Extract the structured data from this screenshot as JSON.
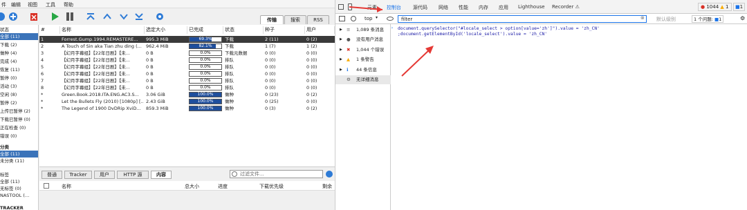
{
  "qb": {
    "menu": [
      "件",
      "编辑",
      "视图",
      "工具",
      "帮助"
    ],
    "search_tabs": [
      "传输",
      "搜索",
      "RSS"
    ],
    "sidebar": {
      "status_header": "状态",
      "status_items": [
        "全部 (11)",
        "下载 (2)",
        "做种 (4)",
        "完成 (4)",
        "恢复 (11)",
        "暂停 (0)",
        "活动 (3)",
        "空闲 (8)",
        "暂停 (2)",
        "上传已暂停 (2)",
        "下载已暂停 (0)",
        "正在检查 (0)",
        "错误 (0)"
      ],
      "category_header": "分类",
      "category_items": [
        "全部 (11)",
        "未分类 (11)"
      ],
      "tag_header": "标签",
      "tag_items": [
        "全部 (11)",
        "无标签 (0)",
        "NASTOOL (…"
      ],
      "tracker_header": "TRACKER"
    },
    "columns": [
      "#",
      "名称",
      "选定大小",
      "已完成",
      "状态",
      "种子",
      "用户"
    ],
    "rows": [
      {
        "num": "1",
        "name": "Forrest.Gump.1994.REMASTERE...",
        "size": "995.3 MiB",
        "progress": 69.3,
        "progress_label": "69.3%",
        "status": "下载",
        "seeds": "2 (11)",
        "peers": "0 (2)"
      },
      {
        "num": "2",
        "name": "A Touch of Sin aka Tian zhu ding (...",
        "size": "962.4 MiB",
        "progress": 82.1,
        "progress_label": "82.1%",
        "status": "下载",
        "seeds": "1 (7)",
        "peers": "1 (2)"
      },
      {
        "num": "3",
        "name": "【幻月字幕组】【22年日剧】【未...",
        "size": "0 B",
        "progress": 0,
        "progress_label": "0.0%",
        "status": "下载元数据",
        "seeds": "0 (0)",
        "peers": "0 (0)"
      },
      {
        "num": "4",
        "name": "【幻月字幕组】【22年日剧】【未...",
        "size": "0 B",
        "progress": 0,
        "progress_label": "0.0%",
        "status": "排队",
        "seeds": "0 (0)",
        "peers": "0 (0)"
      },
      {
        "num": "5",
        "name": "【幻月字幕组】【22年日剧】【未...",
        "size": "0 B",
        "progress": 0,
        "progress_label": "0.0%",
        "status": "排队",
        "seeds": "0 (0)",
        "peers": "0 (0)"
      },
      {
        "num": "6",
        "name": "【幻月字幕组】【22年日剧】【未...",
        "size": "0 B",
        "progress": 0,
        "progress_label": "0.0%",
        "status": "排队",
        "seeds": "0 (0)",
        "peers": "0 (0)"
      },
      {
        "num": "7",
        "name": "【幻月字幕组】【22年日剧】【未...",
        "size": "0 B",
        "progress": 0,
        "progress_label": "0.0%",
        "status": "排队",
        "seeds": "0 (0)",
        "peers": "0 (0)"
      },
      {
        "num": "8",
        "name": "【幻月字幕组】【22年日剧】【未...",
        "size": "0 B",
        "progress": 0,
        "progress_label": "0.0%",
        "status": "排队",
        "seeds": "0 (0)",
        "peers": "0 (0)"
      },
      {
        "num": "*",
        "name": "Green.Book.2018.ITA.ENG.AC3.S...",
        "size": "3.06 GiB",
        "progress": 100,
        "progress_label": "100.0%",
        "status": "做种",
        "seeds": "0 (23)",
        "peers": "0 (2)"
      },
      {
        "num": "*",
        "name": "Let the Bullets Fly (2010) [1080p] [...",
        "size": "2.43 GiB",
        "progress": 100,
        "progress_label": "100.0%",
        "status": "做种",
        "seeds": "0 (25)",
        "peers": "0 (0)"
      },
      {
        "num": "*",
        "name": "The Legend of 1900 DvDRip XviD...",
        "size": "859.3 MiB",
        "progress": 100,
        "progress_label": "100.0%",
        "status": "做种",
        "seeds": "0 (3)",
        "peers": "0 (2)"
      }
    ],
    "bottom_tabs": [
      "普通",
      "Tracker",
      "用户",
      "HTTP 源",
      "内容"
    ],
    "filter_placeholder": "过滤文件...",
    "bottom_columns": [
      "名称",
      "总大小",
      "进度",
      "下载优先级",
      "剩余"
    ]
  },
  "devtools": {
    "tabs": [
      "元素",
      "控制台",
      "源代码",
      "网络",
      "性能",
      "内存",
      "应用",
      "Lighthouse",
      "Recorder ⚠"
    ],
    "errors_count": "1044",
    "warnings_count": "1",
    "info_count": "1",
    "context": "top",
    "filter_value": "filter",
    "level": "默认级别",
    "issues": "1 个问题:",
    "issues_count": "1",
    "sidebar": [
      {
        "label": "1,089 条消息"
      },
      {
        "label": "没有用户消息"
      },
      {
        "label": "1,044 个错误"
      },
      {
        "label": "1 条警告"
      },
      {
        "label": "44 条信息"
      },
      {
        "label": "无详细消息"
      }
    ],
    "console_lines": [
      "document.querySelector(\"#locale_select > option[value='zh']\").value = 'zh_CN'",
      ";document.getElementById('locale_select').value = 'zh_CN'"
    ],
    "colors": {
      "accent": "#1a73e8",
      "error": "#d93025",
      "warning": "#f9ab00",
      "arrow": "#e53935"
    }
  }
}
